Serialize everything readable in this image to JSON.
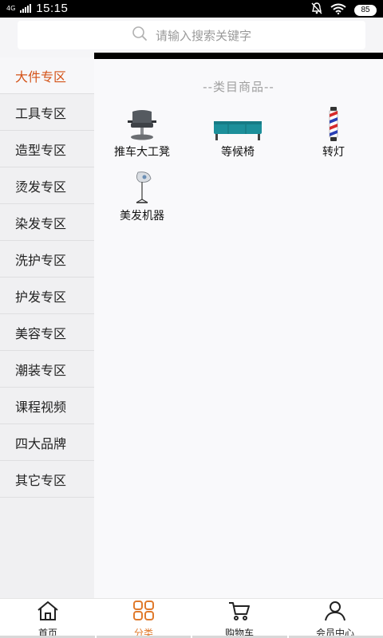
{
  "status_bar": {
    "network": "4G",
    "time": "15:15",
    "battery": "85",
    "icons": [
      "signal-icon",
      "mute-bell-icon",
      "wifi-icon",
      "battery-icon"
    ]
  },
  "search": {
    "placeholder": "请输入搜索关键字",
    "icon": "search-icon"
  },
  "sidebar": {
    "items": [
      {
        "label": "大件专区",
        "active": true
      },
      {
        "label": "工具专区"
      },
      {
        "label": "造型专区"
      },
      {
        "label": "烫发专区"
      },
      {
        "label": "染发专区"
      },
      {
        "label": "洗护专区"
      },
      {
        "label": "护发专区"
      },
      {
        "label": "美容专区"
      },
      {
        "label": "潮装专区"
      },
      {
        "label": "课程视频"
      },
      {
        "label": "四大品牌"
      },
      {
        "label": "其它专区"
      }
    ]
  },
  "content": {
    "section_title": "--类目商品--",
    "products": [
      {
        "name": "推车大工凳",
        "icon": "salon-chair-icon"
      },
      {
        "name": "等候椅",
        "icon": "waiting-bench-icon"
      },
      {
        "name": "转灯",
        "icon": "barber-pole-icon"
      },
      {
        "name": "美发机器",
        "icon": "hair-steamer-icon"
      }
    ]
  },
  "tabbar": {
    "tabs": [
      {
        "label": "首页",
        "icon": "home-icon"
      },
      {
        "label": "分类",
        "icon": "category-grid-icon",
        "active": true
      },
      {
        "label": "购物车",
        "icon": "cart-icon"
      },
      {
        "label": "会员中心",
        "icon": "user-icon"
      }
    ]
  },
  "colors": {
    "accent": "#d45318",
    "tab_active": "#e07a2c",
    "sidebar_bg": "#f0f0f2",
    "content_bg": "#f9f9fb"
  }
}
